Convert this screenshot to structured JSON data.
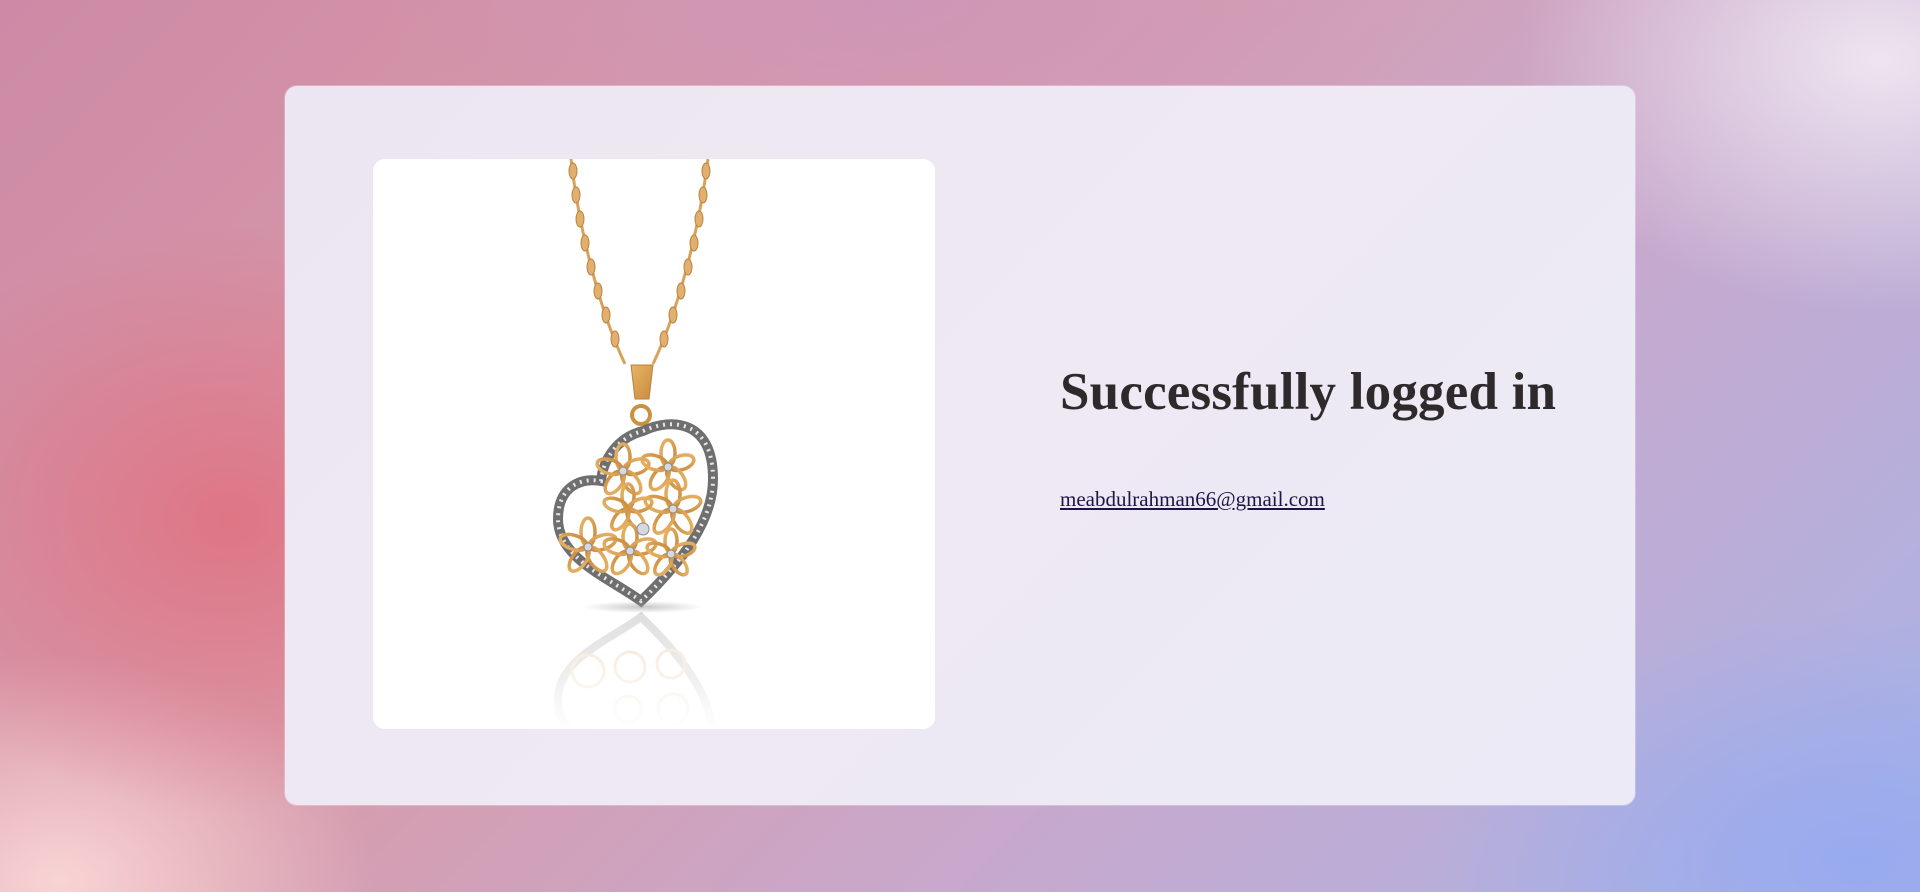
{
  "page": {
    "title": "Successfully logged in",
    "email": "meabdulrahman66@gmail.com"
  },
  "image": {
    "icon": "heart-pendant-necklace-image"
  },
  "colors": {
    "title_text": "#2e2a2c",
    "email_link": "#1d1546",
    "card_background": "#eee9f3",
    "image_background": "#ffffff",
    "gold": "#d99a48",
    "silver": "#8a8a8a"
  }
}
